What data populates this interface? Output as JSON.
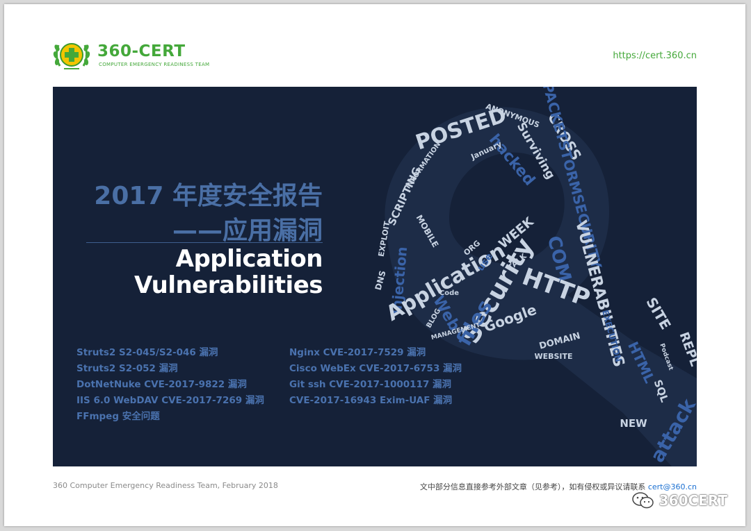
{
  "header": {
    "brand_name": "360-CERT",
    "brand_subtitle": "COMPUTER EMERGENCY READINESS TEAM",
    "url": "https://cert.360.cn"
  },
  "banner": {
    "title_cn_line1": "2017 年度安全报告",
    "title_cn_line2": "——应用漏洞",
    "title_en_line1": "Application",
    "title_en_line2": "Vulnerabilities",
    "vulns_left": [
      "Struts2 S2-045/S2-046 漏洞",
      "Struts2 S2-052 漏洞",
      "DotNetNuke CVE-2017-9822 漏洞",
      "IIS 6.0 WebDAV CVE-2017-7269 漏洞",
      "FFmpeg 安全问题"
    ],
    "vulns_right": [
      "Nginx CVE-2017-7529 漏洞",
      "Cisco WebEx CVE-2017-6753 漏洞",
      "Git ssh CVE-2017-1000117 漏洞",
      "CVE-2017-16943 Exim-UAF 漏洞"
    ],
    "wordcloud_words": [
      "POSTED",
      "ANONYMOUS",
      "CROSS",
      "Surviving",
      "hacked",
      "January",
      "SCRIPTING",
      "INFORMATION",
      "Injection",
      "WEEK",
      "PACKETSTORMSECURITY",
      "Application",
      "Security",
      "COM",
      "HTTP",
      "files",
      "Web",
      "Google",
      "DOMAIN",
      "WEBSITE",
      "VULNERABILITIES",
      "HTML",
      "SITE",
      "NEW",
      "MOBILE",
      "DNS",
      "EXPLOIT",
      "TALK",
      "BLOG",
      "Code",
      "use",
      "ORG",
      "EXECUTION",
      "MANAGEMENT",
      "SQL",
      "REPL",
      "attack",
      "Podcast"
    ]
  },
  "footer": {
    "left_text": "360 Computer Emergency Readiness Team, February 2018",
    "right_text": "文中部分信息直接参考外部文章（见参考），如有侵权或异议请联系 ",
    "email": "cert@360.cn",
    "watermark": "360CERT"
  },
  "colors": {
    "brand_green": "#44a83a",
    "banner_bg": "#152138",
    "title_blue": "#4a6fa5",
    "cloud_light": "#c8d3e2",
    "cloud_blue": "#3a63a8"
  }
}
